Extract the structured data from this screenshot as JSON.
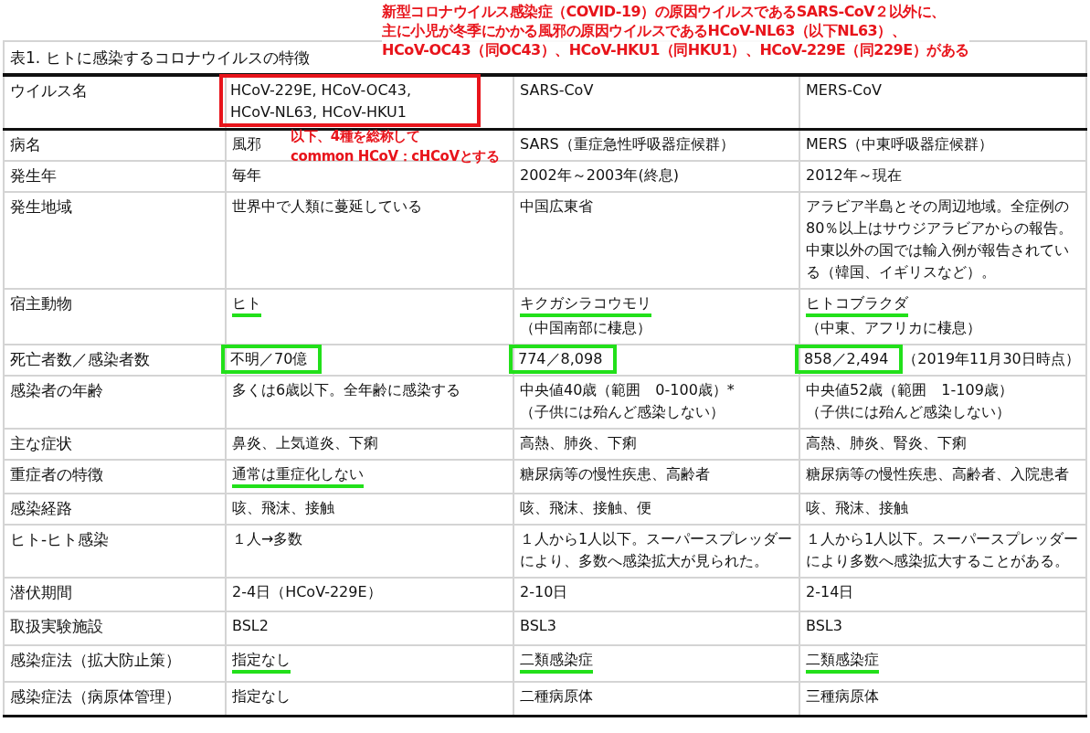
{
  "annotation_top": {
    "lines": [
      "新型コロナウイルス感染症（COVID-19）の原因ウイルスであるSARS-CoV２以外に、",
      "主に小児が冬季にかかる風邪の原因ウイルスであるHCoV-NL63（以下NL63）、",
      "HCoV-OC43（同OC43）、HCoV-HKU1（同HKU1）、HCoV-229E（同229E）がある"
    ]
  },
  "annotation_mid": {
    "lines": [
      "以下、4種を総称して",
      "common HCoV：cHCoVとする"
    ]
  },
  "table": {
    "caption": "表1. ヒトに感染するコロナウイルスの特徴",
    "header": {
      "label": "ウイルス名",
      "columns": [
        {
          "text": "HCoV-229E, HCoV-OC43, HCoV-NL63, HCoV-HKU1",
          "boxed": true,
          "color": "#e8141b"
        },
        {
          "text": "SARS-CoV",
          "boxed": false
        },
        {
          "text": "MERS-CoV",
          "boxed": false
        }
      ]
    },
    "rows": [
      {
        "label": "病名",
        "cells": [
          {
            "text": "風邪"
          },
          {
            "text": "SARS（重症急性呼吸器症候群）"
          },
          {
            "text": "MERS（中東呼吸器症候群）"
          }
        ]
      },
      {
        "label": "発生年",
        "cells": [
          {
            "text": "毎年"
          },
          {
            "text": "2002年～2003年(終息)"
          },
          {
            "text": "2012年～現在"
          }
        ]
      },
      {
        "label": "発生地域",
        "cells": [
          {
            "text": "世界中で人類に蔓延している"
          },
          {
            "text": "中国広東省"
          },
          {
            "text": "アラビア半島とその周辺地域。全症例の80％以上はサウジアラビアからの報告。中東以外の国では輸入例が報告されている（韓国、イギリスなど）。"
          }
        ]
      },
      {
        "label": "宿主動物",
        "cells": [
          {
            "text": "ヒト",
            "underlined": true
          },
          {
            "text": "キクガシラコウモリ",
            "underlined": true,
            "note": "（中国南部に棲息）"
          },
          {
            "text": "ヒトコブラクダ",
            "underlined": true,
            "note": "（中東、アフリカに棲息）"
          }
        ]
      },
      {
        "label": "死亡者数／感染者数",
        "cells": [
          {
            "text": "不明／70億",
            "boxed": true,
            "color": "#22e01a"
          },
          {
            "text": "774／8,098",
            "boxed": true,
            "color": "#22e01a"
          },
          {
            "text": "858／2,494",
            "boxed": true,
            "color": "#22e01a",
            "suffix": "（2019年11月30日時点）"
          }
        ]
      },
      {
        "label": "感染者の年齢",
        "cells": [
          {
            "text": "多くは6歳以下。全年齢に感染する"
          },
          {
            "text": "中央値40歳（範囲　0-100歳）*",
            "note": "（子供には殆んど感染しない）"
          },
          {
            "text": "中央値52歳（範囲　1-109歳）",
            "note": "（子供には殆んど感染しない）"
          }
        ]
      },
      {
        "label": "主な症状",
        "cells": [
          {
            "text": "鼻炎、上気道炎、下痢"
          },
          {
            "text": "高熱、肺炎、下痢"
          },
          {
            "text": "高熱、肺炎、腎炎、下痢"
          }
        ]
      },
      {
        "label": "重症者の特徴",
        "cells": [
          {
            "text": "通常は重症化しない",
            "underlined": true
          },
          {
            "text": "糖尿病等の慢性疾患、高齢者"
          },
          {
            "text": "糖尿病等の慢性疾患、高齢者、入院患者"
          }
        ]
      },
      {
        "label": "感染経路",
        "cells": [
          {
            "text": "咳、飛沫、接触"
          },
          {
            "text": "咳、飛沫、接触、便"
          },
          {
            "text": "咳、飛沫、接触"
          }
        ]
      },
      {
        "label": "ヒト-ヒト感染",
        "cells": [
          {
            "text": "１人→多数"
          },
          {
            "text": "１人から1人以下。スーパースプレッダーにより、多数へ感染拡大が見られた。"
          },
          {
            "text": "１人から1人以下。スーパースプレッダーにより多数へ感染拡大することがある。"
          }
        ]
      },
      {
        "label": "潜伏期間",
        "cells": [
          {
            "text": "2-4日（HCoV-229E）"
          },
          {
            "text": "2-10日"
          },
          {
            "text": "2-14日"
          }
        ]
      },
      {
        "label": "取扱実験施設",
        "cells": [
          {
            "text": "BSL2"
          },
          {
            "text": "BSL3"
          },
          {
            "text": "BSL3"
          }
        ]
      },
      {
        "label": "感染症法（拡大防止策）",
        "cells": [
          {
            "text": "指定なし",
            "underlined": true
          },
          {
            "text": "二類感染症",
            "underlined": true
          },
          {
            "text": "二類感染症",
            "underlined": true
          }
        ]
      },
      {
        "label": "感染症法（病原体管理）",
        "cells": [
          {
            "text": "指定なし"
          },
          {
            "text": "二種病原体"
          },
          {
            "text": "三種病原体"
          }
        ]
      }
    ]
  }
}
